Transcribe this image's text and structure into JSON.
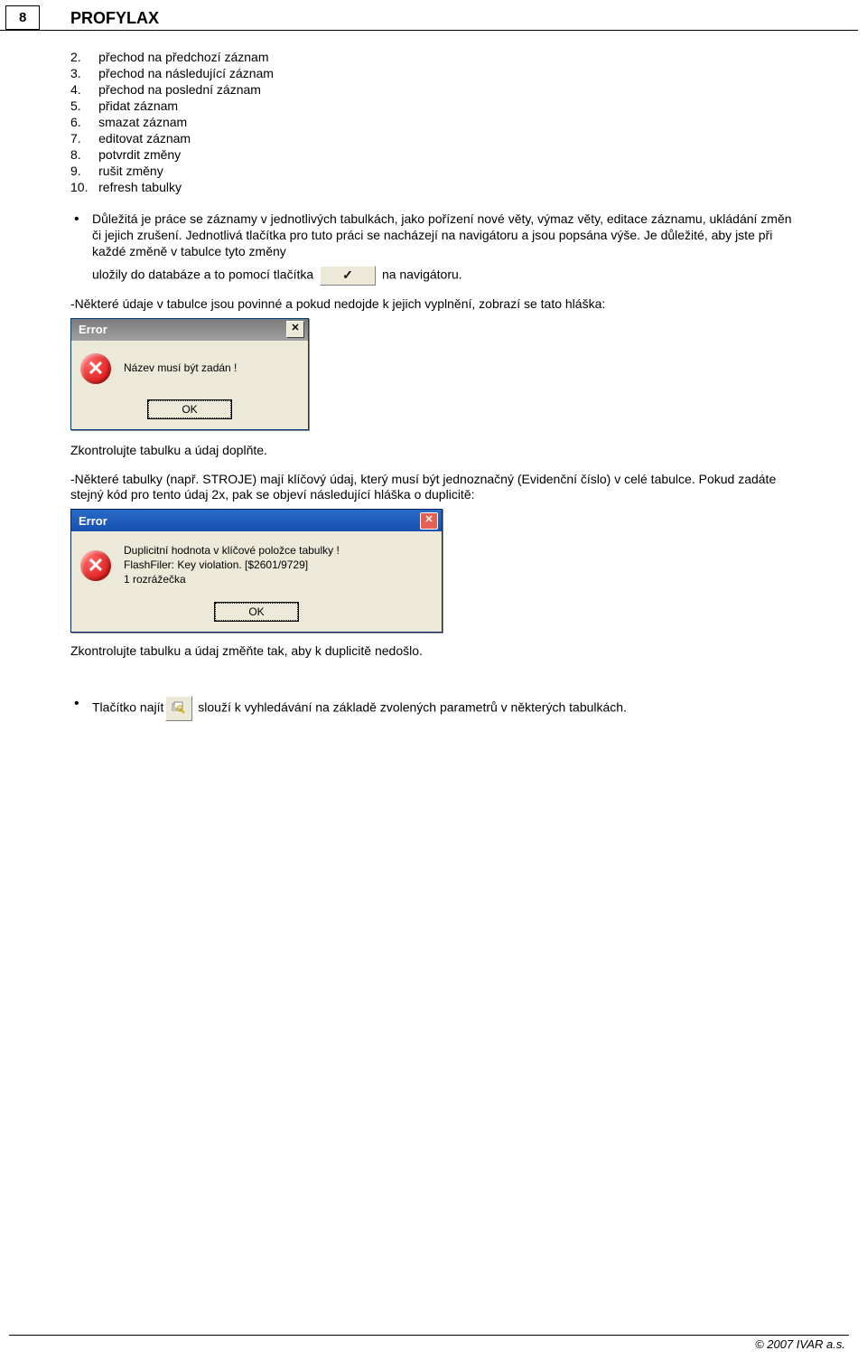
{
  "page_number": "8",
  "header_title": "PROFYLAX",
  "list": {
    "items": [
      {
        "n": "2.",
        "t": "přechod na předchozí záznam"
      },
      {
        "n": "3.",
        "t": "přechod na následující záznam"
      },
      {
        "n": "4.",
        "t": "přechod na poslední záznam"
      },
      {
        "n": "5.",
        "t": "přidat záznam"
      },
      {
        "n": "6.",
        "t": "smazat záznam"
      },
      {
        "n": "7.",
        "t": "editovat záznam"
      },
      {
        "n": "8.",
        "t": "potvrdit změny"
      },
      {
        "n": "9.",
        "t": "rušit změny"
      },
      {
        "n": "10.",
        "t": "refresh tabulky"
      }
    ]
  },
  "p1_a": "Důležitá je práce se záznamy v jednotlivých tabulkách, jako pořízení nové věty, výmaz věty, editace záznamu, ukládání změn či jejich zrušení. Jednotlivá tlačítka pro tuto práci se nacházejí na navigátoru a jsou popsána výše. Je důležité, aby jste při každé změně v tabulce tyto změny",
  "p1_b": "uložily do databáze a to pomocí tlačítka",
  "p1_c": "na navigátoru.",
  "p2": "-Některé údaje v tabulce jsou povinné a pokud nedojde k jejich vyplnění, zobrazí se tato hláška:",
  "dialog1": {
    "title": "Error",
    "close": "✕",
    "msg": "Název musí být zadán !",
    "ok": "OK"
  },
  "p3": "Zkontrolujte tabulku a údaj doplňte.",
  "p4": "-Některé tabulky (např. STROJE) mají klíčový údaj, který musí být jednoznačný (Evidenční číslo) v celé tabulce. Pokud zadáte stejný kód pro tento údaj 2x, pak se objeví následující hláška o duplicitě:",
  "dialog2": {
    "title": "Error",
    "close": "✕",
    "msg1": "Duplicitní hodnota v klíčové položce tabulky !",
    "msg2": "FlashFiler: Key violation. [$2601/9729]",
    "msg3": "1 rozrážečka",
    "ok": "OK"
  },
  "p5": "Zkontrolujte tabulku a údaj změňte tak, aby k duplicitě nedošlo.",
  "p6_a": "Tlačítko najít",
  "p6_b": "slouží k vyhledávání na základě zvolených parametrů v některých tabulkách.",
  "check_glyph": "✓",
  "footer": "© 2007 IVAR a.s."
}
